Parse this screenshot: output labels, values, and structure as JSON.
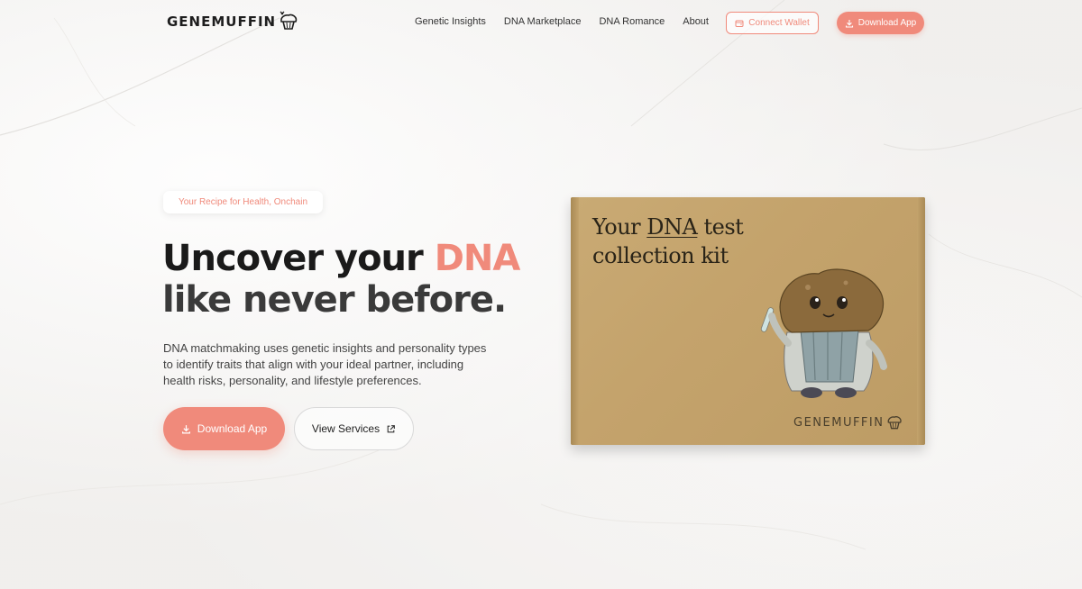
{
  "brand": {
    "name": "GENEMUFFIN"
  },
  "nav": {
    "links": [
      "Genetic Insights",
      "DNA Marketplace",
      "DNA Romance",
      "About"
    ],
    "connect_wallet": "Connect Wallet",
    "download_app": "Download App"
  },
  "hero": {
    "badge": "Your Recipe for Health, Onchain",
    "headline_part1": "Uncover your ",
    "headline_accent": "DNA",
    "headline_line2": "like never before.",
    "description": "DNA matchmaking uses genetic insights and personality types to identify traits that align with your ideal partner, including health risks, personality, and lifestyle preferences.",
    "primary_button": "Download App",
    "secondary_button": "View Services"
  },
  "kit": {
    "title_prefix": "Your ",
    "title_underlined": "DNA",
    "title_suffix": " test collection kit",
    "logo_text": "GENEMUFFIN"
  },
  "colors": {
    "accent": "#f08a7b",
    "text_dark": "#1a1a1a",
    "kraft": "#c4a36c"
  },
  "icons": [
    "muffin-logo-icon",
    "wallet-icon",
    "download-icon",
    "external-link-icon"
  ]
}
